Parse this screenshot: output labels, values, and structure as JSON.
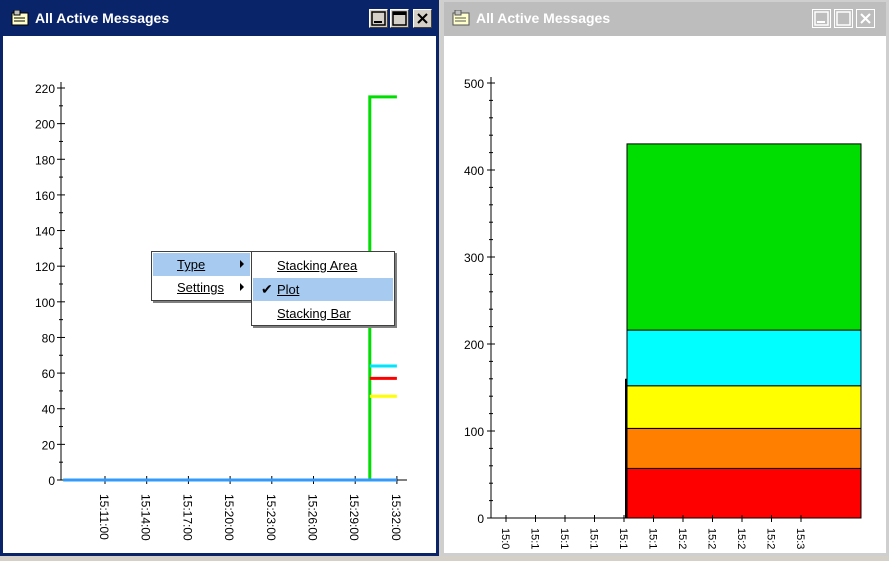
{
  "left_window": {
    "title": "All Active Messages",
    "icon": "app-icon",
    "buttons": [
      "minimize-icon",
      "maximize-icon",
      "close-icon"
    ]
  },
  "right_window": {
    "title": "All Active Messages",
    "icon": "app-icon",
    "buttons": [
      "minimize-icon",
      "maximize-icon",
      "close-icon"
    ]
  },
  "context_menu": {
    "items": [
      {
        "label": "Type",
        "has_submenu": true,
        "highlighted": true
      },
      {
        "label": "Settings",
        "has_submenu": true,
        "highlighted": false
      }
    ]
  },
  "submenu": {
    "items": [
      {
        "label": "Stacking Area",
        "checked": false,
        "highlighted": false
      },
      {
        "label": "Plot",
        "checked": true,
        "highlighted": true
      },
      {
        "label": "Stacking Bar",
        "checked": false,
        "highlighted": false
      }
    ]
  },
  "chart_data": [
    {
      "type": "line",
      "y_ticks": [
        "0",
        "20",
        "40",
        "60",
        "80",
        "100",
        "120",
        "140",
        "160",
        "180",
        "200",
        "220"
      ],
      "ylim": [
        0,
        220
      ],
      "x_ticks": [
        "15:11:00",
        "15:14:00",
        "15:17:00",
        "15:20:00",
        "15:23:00",
        "15:26:00",
        "15:29:00",
        "15:32:00"
      ],
      "series": [
        {
          "color": "#00dd00",
          "points": [
            [
              0,
              0
            ],
            [
              7.35,
              0
            ],
            [
              7.35,
              215
            ],
            [
              8,
              215
            ]
          ]
        },
        {
          "color": "#00e5ff",
          "points": [
            [
              7.35,
              64
            ],
            [
              8,
              64
            ]
          ]
        },
        {
          "color": "#ff0000",
          "points": [
            [
              7.35,
              57
            ],
            [
              8,
              57
            ]
          ]
        },
        {
          "color": "#ffff00",
          "points": [
            [
              7.35,
              47
            ],
            [
              8,
              47
            ]
          ]
        },
        {
          "color": "#3399ff",
          "points": [
            [
              0,
              0
            ],
            [
              8,
              0
            ]
          ]
        }
      ]
    },
    {
      "type": "area",
      "y_ticks": [
        "0",
        "100",
        "200",
        "300",
        "400",
        "500"
      ],
      "ylim": [
        0,
        500
      ],
      "x_ticks": [
        "15:0",
        "15:1",
        "15:1",
        "15:1",
        "15:1",
        "15:1",
        "15:2",
        "15:2",
        "15:2",
        "15:2",
        "15:3"
      ],
      "start_index": 4,
      "layers": [
        {
          "color": "#ff0000",
          "top": 57
        },
        {
          "color": "#ff8000",
          "top": 103
        },
        {
          "color": "#ffff00",
          "top": 152
        },
        {
          "color": "#00ffff",
          "top": 216
        },
        {
          "color": "#00dd00",
          "top": 430
        }
      ]
    }
  ]
}
